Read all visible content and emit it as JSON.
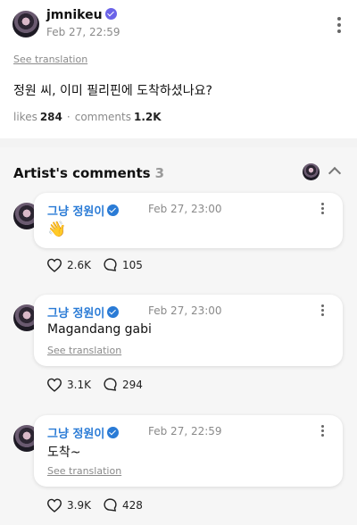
{
  "post": {
    "username": "jmnikeu",
    "date": "Feb 27, 22:59",
    "see_translation": "See translation",
    "text": "정원 씨, 이미 필리핀에 도착하셨나요?",
    "likes_label": "likes",
    "likes": "284",
    "comments_label": "comments",
    "comments": "1.2K"
  },
  "artist_comments": {
    "title": "Artist's comments",
    "count": "3",
    "items": [
      {
        "name": "그냥 정원이",
        "date": "Feb 27, 23:00",
        "text": "👋",
        "see_translation": "",
        "likes": "2.6K",
        "replies": "105"
      },
      {
        "name": "그냥 정원이",
        "date": "Feb 27, 23:00",
        "text": "Magandang gabi",
        "see_translation": "See translation",
        "likes": "3.1K",
        "replies": "294"
      },
      {
        "name": "그냥 정원이",
        "date": "Feb 27, 22:59",
        "text": "도착~",
        "see_translation": "See translation",
        "likes": "3.9K",
        "replies": "428"
      }
    ]
  },
  "colors": {
    "verified_post": "#6b63e8",
    "artist_name": "#2a7bd6",
    "muted": "#8a8a8a",
    "section_bg": "#f6f6f6"
  }
}
